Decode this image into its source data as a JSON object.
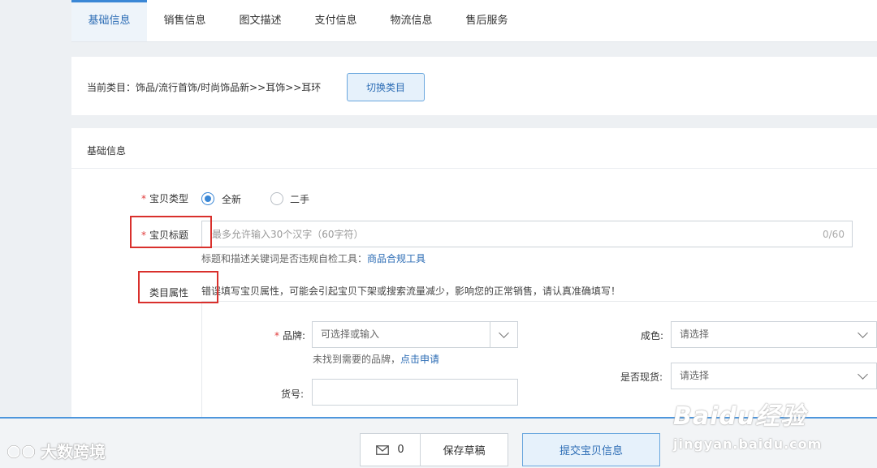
{
  "tabs": [
    {
      "label": "基础信息",
      "active": true
    },
    {
      "label": "销售信息"
    },
    {
      "label": "图文描述"
    },
    {
      "label": "支付信息"
    },
    {
      "label": "物流信息"
    },
    {
      "label": "售后服务"
    }
  ],
  "category": {
    "current_text": "当前类目：饰品/流行首饰/时尚饰品新>>耳饰>>耳环",
    "switch_label": "切换类目"
  },
  "basic": {
    "section_title": "基础信息",
    "item_type": {
      "label": "宝贝类型",
      "options": [
        "全新",
        "二手"
      ],
      "selected": "全新"
    },
    "title_field": {
      "label": "宝贝标题",
      "placeholder": "最多允许输入30个汉字（60字符）",
      "counter": "0/60",
      "hint_prefix": "标题和描述关键词是否违规自检工具：",
      "hint_link": "商品合规工具"
    },
    "attributes": {
      "label": "类目属性",
      "warning": "错误填写宝贝属性，可能会引起宝贝下架或搜索流量减少，影响您的正常销售，请认真准确填写！",
      "brand": {
        "label": "品牌",
        "placeholder": "可选择或输入",
        "hint_prefix": "未找到需要的品牌，",
        "hint_link": "点击申请"
      },
      "item_no": {
        "label": "货号",
        "value": ""
      },
      "color": {
        "label": "成色",
        "placeholder": "请选择"
      },
      "in_stock": {
        "label": "是否现货",
        "placeholder": "请选择"
      }
    }
  },
  "footer": {
    "message_count": "0",
    "save_draft": "保存草稿",
    "submit": "提交宝贝信息"
  },
  "watermarks": {
    "left": "大数跨境",
    "brand": "Baidu经验",
    "url": "jingyan.baidu.com"
  },
  "colors": {
    "accent": "#3a87d6",
    "required": "#e03b3b",
    "highlight_box": "#d9302c"
  }
}
